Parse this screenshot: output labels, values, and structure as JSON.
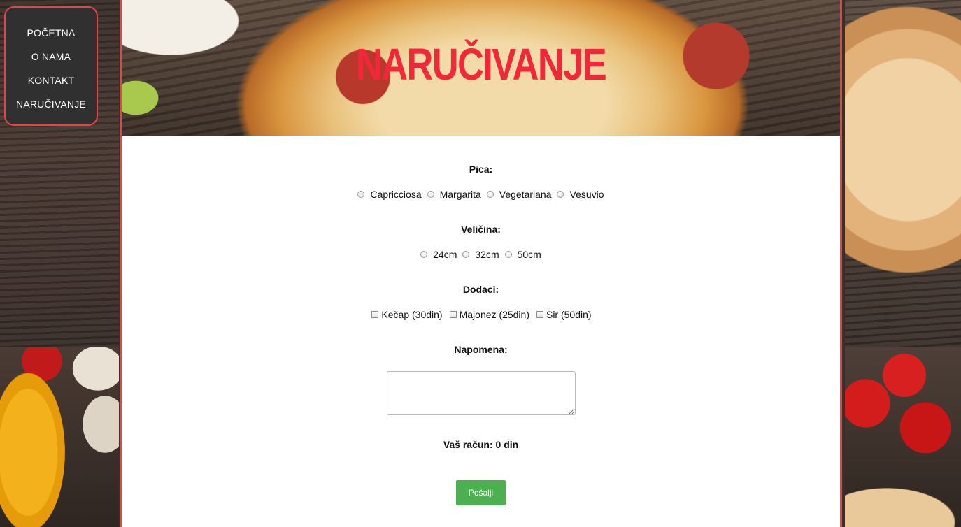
{
  "nav": {
    "items": [
      "POČETNA",
      "O NAMA",
      "KONTAKT",
      "NARUČIVANJE"
    ]
  },
  "banner": {
    "title": "NARUČIVANJE"
  },
  "form": {
    "pizza": {
      "label": "Pica:",
      "options": [
        "Capricciosa",
        "Margarita",
        "Vegetariana",
        "Vesuvio"
      ]
    },
    "size": {
      "label": "Veličina:",
      "options": [
        "24cm",
        "32cm",
        "50cm"
      ]
    },
    "extras": {
      "label": "Dodaci:",
      "options": [
        "Kečap (30din)",
        "Majonez (25din)",
        "Sir (50din)"
      ]
    },
    "note": {
      "label": "Napomena:",
      "value": ""
    },
    "total": {
      "text": "Vaš račun: 0 din"
    },
    "submit_label": "Pošalji"
  },
  "colors": {
    "accent": "#e8424a",
    "title": "#f0283a",
    "button": "#4caf50",
    "nav_bg": "#303030"
  }
}
